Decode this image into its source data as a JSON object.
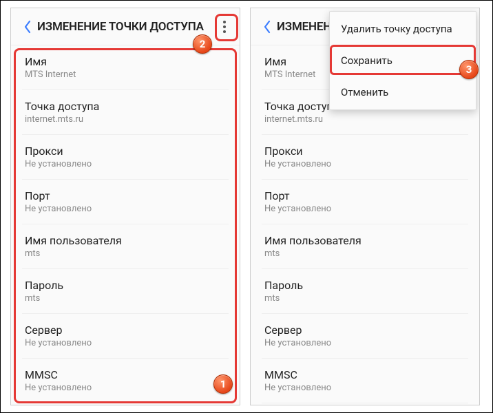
{
  "header": {
    "title": "ИЗМЕНЕНИЕ ТОЧКИ ДОСТУПА"
  },
  "fields": [
    {
      "label": "Имя",
      "value": "MTS Internet"
    },
    {
      "label": "Точка доступа",
      "value": "internet.mts.ru"
    },
    {
      "label": "Прокси",
      "value": "Не установлено"
    },
    {
      "label": "Порт",
      "value": "Не установлено"
    },
    {
      "label": "Имя пользователя",
      "value": "mts"
    },
    {
      "label": "Пароль",
      "value": "mts"
    },
    {
      "label": "Сервер",
      "value": "Не установлено"
    },
    {
      "label": "MMSC",
      "value": "Не установлено"
    }
  ],
  "menu": {
    "delete": "Удалить точку доступа",
    "save": "Сохранить",
    "cancel": "Отменить"
  },
  "badges": {
    "b1": "1",
    "b2": "2",
    "b3": "3"
  }
}
